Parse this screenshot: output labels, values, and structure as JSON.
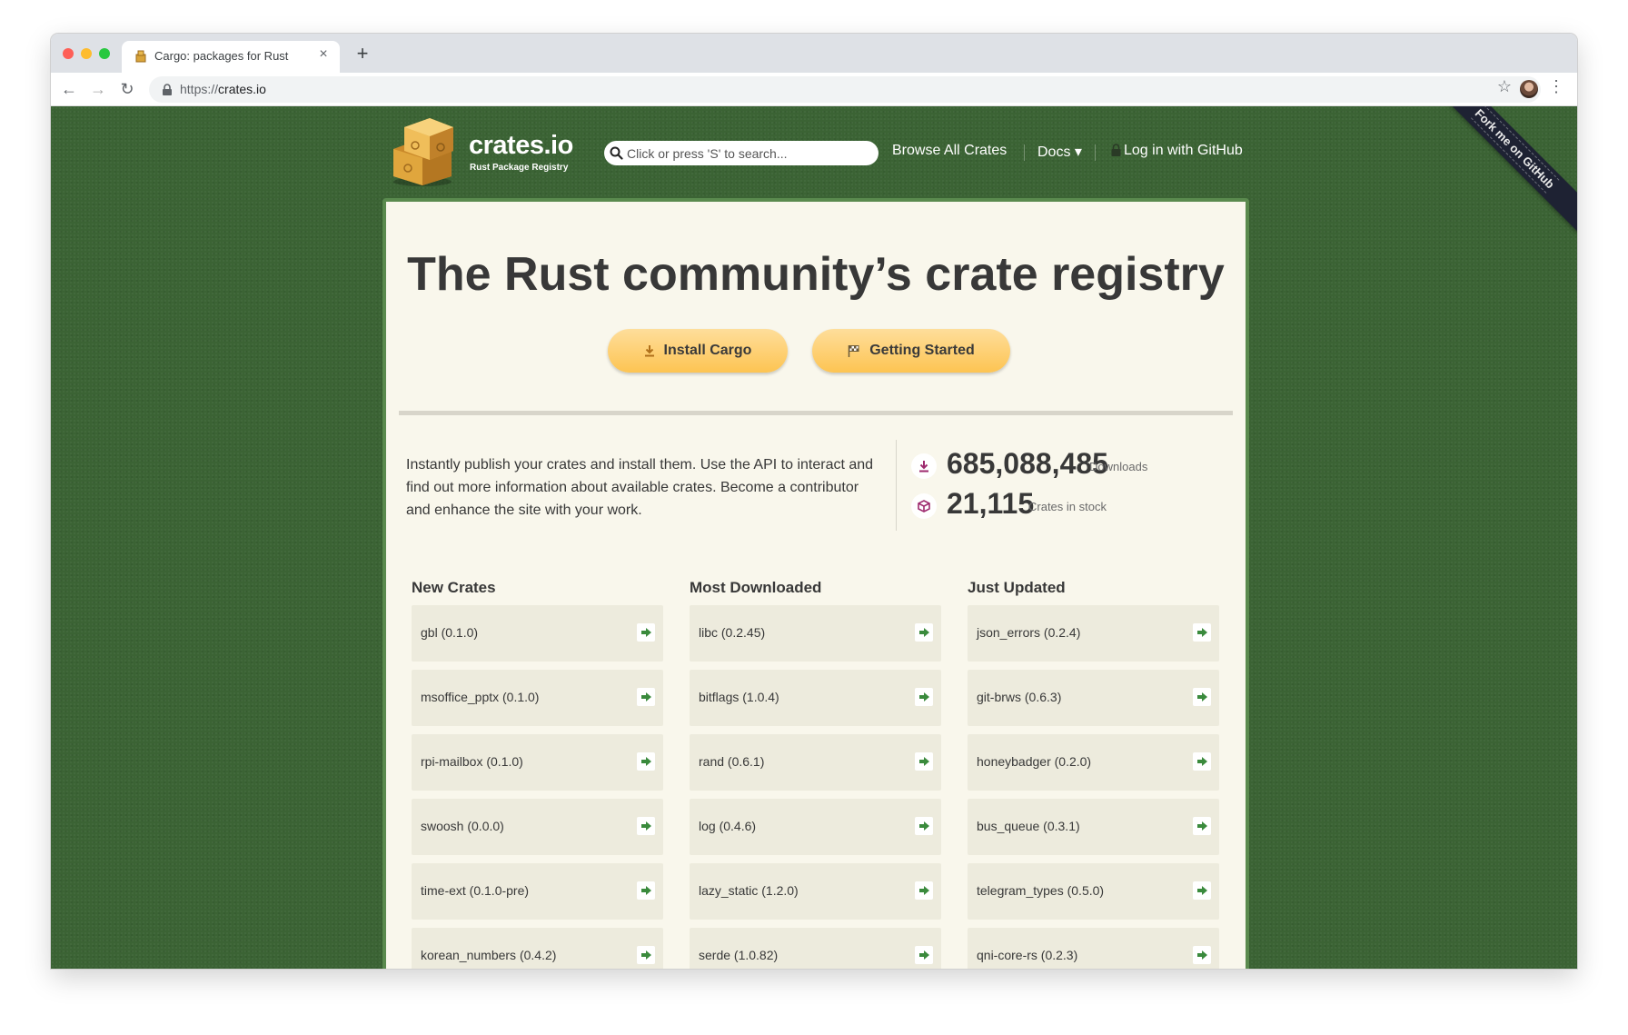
{
  "browser": {
    "tab_title": "Cargo: packages for Rust",
    "tab_close": "×",
    "new_tab": "+",
    "url_scheme": "https://",
    "url_host": "crates.io",
    "back": "←",
    "forward": "→",
    "reload": "↻",
    "star": "☆",
    "menu": "⋮"
  },
  "ribbon": {
    "label": "Fork me on GitHub"
  },
  "header": {
    "logo_title": "crates.io",
    "logo_subtitle": "Rust Package Registry",
    "search_placeholder": "Click or press 'S' to search...",
    "nav": {
      "browse": "Browse All Crates",
      "docs": "Docs ▾",
      "login": "Log in with GitHub"
    }
  },
  "hero": {
    "title": "The Rust community’s crate registry",
    "install_button": "Install Cargo",
    "getting_started_button": "Getting Started"
  },
  "intro": {
    "text": "Instantly publish your crates and install them. Use the API to interact and find out more information about available crates. Become a contributor and enhance the site with your work."
  },
  "stats": {
    "downloads_value": "685,088,485",
    "downloads_label": "Downloads",
    "crates_value": "21,115",
    "crates_label": "Crates in stock"
  },
  "columns": [
    {
      "title": "New Crates",
      "items": [
        "gbl (0.1.0)",
        "msoffice_pptx (0.1.0)",
        "rpi-mailbox (0.1.0)",
        "swoosh (0.0.0)",
        "time-ext (0.1.0-pre)",
        "korean_numbers (0.4.2)"
      ]
    },
    {
      "title": "Most Downloaded",
      "items": [
        "libc (0.2.45)",
        "bitflags (1.0.4)",
        "rand (0.6.1)",
        "log (0.4.6)",
        "lazy_static (1.2.0)",
        "serde (1.0.82)"
      ]
    },
    {
      "title": "Just Updated",
      "items": [
        "json_errors (0.2.4)",
        "git-brws (0.6.3)",
        "honeybadger (0.2.0)",
        "bus_queue (0.3.1)",
        "telegram_types (0.5.0)",
        "qni-core-rs (0.2.3)"
      ]
    }
  ],
  "icons": {
    "download": "download-icon",
    "flag": "flag-icon",
    "cube": "cube-icon",
    "arrow": "arrow-right-icon"
  },
  "colors": {
    "background_green": "#3b6334",
    "panel": "#f9f7ec",
    "button_yellow": "#fdc452",
    "stat_icon": "#9e2a6e",
    "arrow_green": "#3a8a3c"
  }
}
